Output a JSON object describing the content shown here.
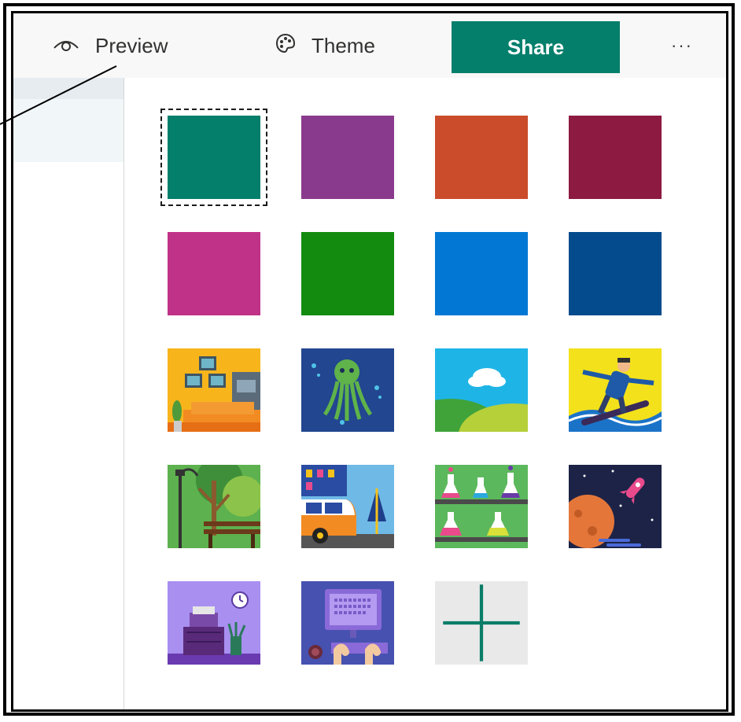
{
  "toolbar": {
    "preview_label": "Preview",
    "theme_label": "Theme",
    "share_label": "Share",
    "more_label": "···",
    "share_color": "#047f6c"
  },
  "theme_tiles": [
    {
      "kind": "color",
      "color": "#047f6c",
      "selected": true
    },
    {
      "kind": "color",
      "color": "#8a3a8c"
    },
    {
      "kind": "color",
      "color": "#ca4c2a"
    },
    {
      "kind": "color",
      "color": "#8d1a40"
    },
    {
      "kind": "color",
      "color": "#c03288"
    },
    {
      "kind": "color",
      "color": "#138b0e"
    },
    {
      "kind": "color",
      "color": "#0278d4"
    },
    {
      "kind": "color",
      "color": "#034b8c"
    },
    {
      "kind": "image",
      "icon": "living-room-image"
    },
    {
      "kind": "image",
      "icon": "octopus-image"
    },
    {
      "kind": "image",
      "icon": "cloud-hills-image"
    },
    {
      "kind": "image",
      "icon": "snowboarder-image"
    },
    {
      "kind": "image",
      "icon": "park-bench-image"
    },
    {
      "kind": "image",
      "icon": "camper-van-image"
    },
    {
      "kind": "image",
      "icon": "lab-flasks-image"
    },
    {
      "kind": "image",
      "icon": "planet-rocket-image"
    },
    {
      "kind": "image",
      "icon": "desk-clock-image"
    },
    {
      "kind": "image",
      "icon": "computer-typing-image"
    },
    {
      "kind": "add",
      "icon": "plus-icon"
    }
  ]
}
